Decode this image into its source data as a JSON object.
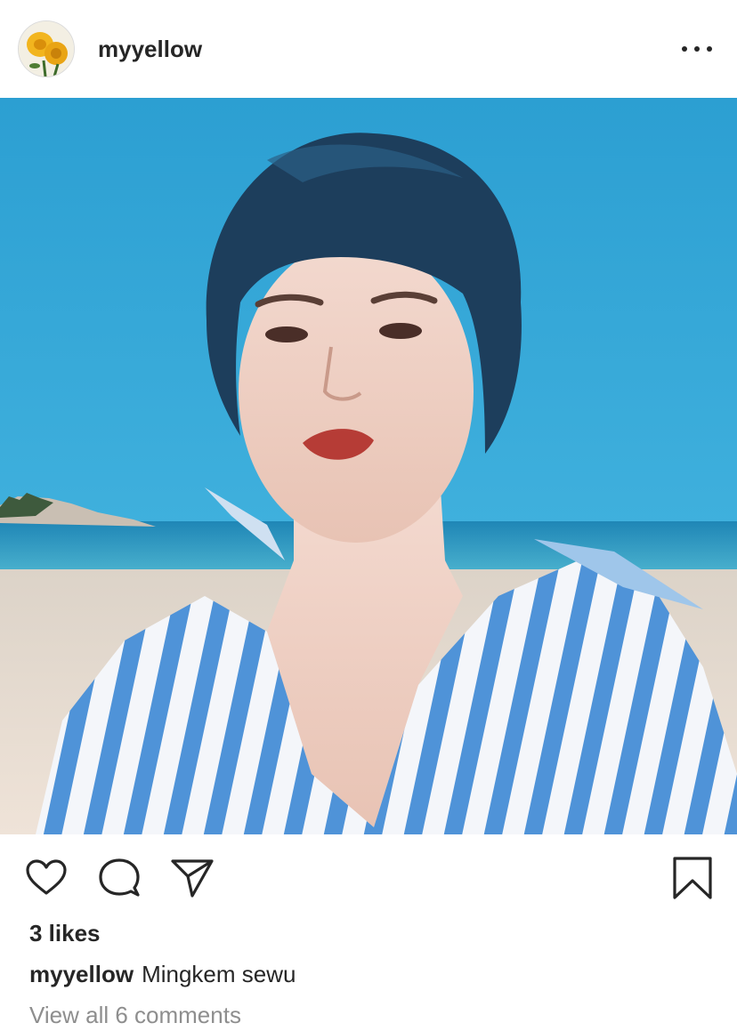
{
  "post": {
    "username": "myyellow",
    "more_icon": "more-horizontal-icon",
    "photo_alt": "",
    "actions": {
      "like_icon": "heart-icon",
      "comment_icon": "comment-bubble-icon",
      "share_icon": "paper-plane-icon",
      "save_icon": "bookmark-icon"
    },
    "likes": "3 likes",
    "caption": {
      "username": "myyellow",
      "text": "Mingkem sewu"
    },
    "view_comments": "View all 6 comments"
  },
  "colors": {
    "text": "#262626",
    "muted": "#8e8e8e",
    "sky": "#2e9fd0",
    "sea": "#2f8fb8",
    "sand": "#e9ddd2"
  }
}
